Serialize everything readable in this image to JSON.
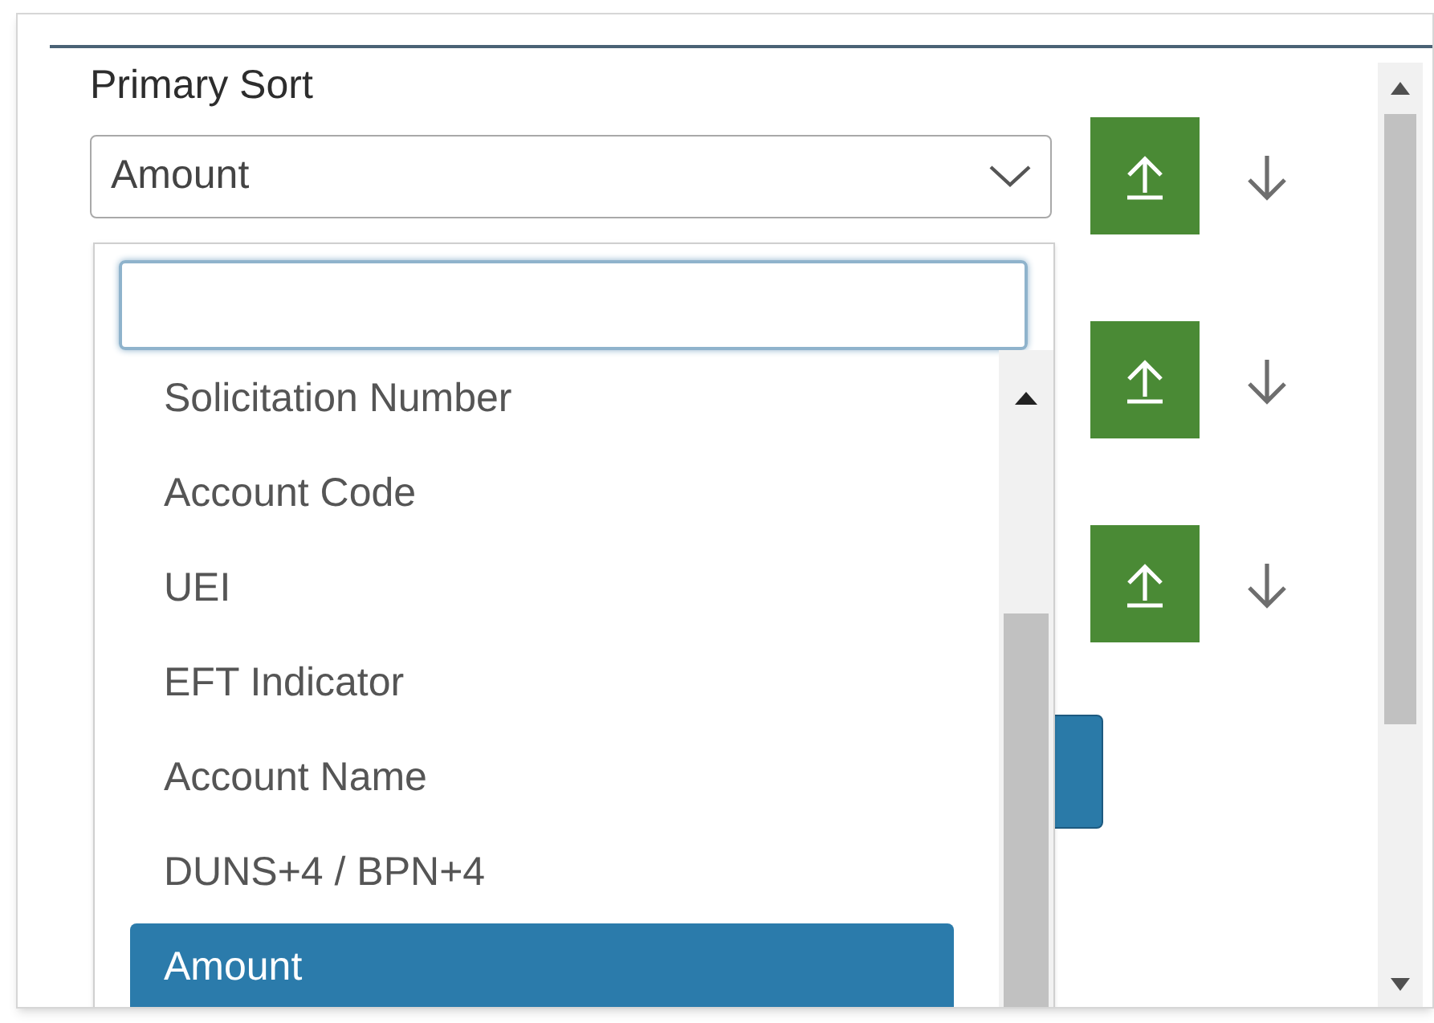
{
  "primary_sort": {
    "label": "Primary Sort",
    "value": "Amount"
  },
  "sort_rows": [
    {
      "ascending": {
        "selected": true
      },
      "descending": {
        "selected": false
      }
    },
    {
      "ascending": {
        "selected": true
      },
      "descending": {
        "selected": false
      }
    },
    {
      "ascending": {
        "selected": true
      },
      "descending": {
        "selected": false
      }
    }
  ],
  "dropdown": {
    "options": [
      {
        "label": "Solicitation Number",
        "selected": false
      },
      {
        "label": "Account Code",
        "selected": false
      },
      {
        "label": "UEI",
        "selected": false
      },
      {
        "label": "EFT Indicator",
        "selected": false
      },
      {
        "label": "Account Name",
        "selected": false
      },
      {
        "label": "DUNS+4 / BPN+4",
        "selected": false
      },
      {
        "label": "Amount",
        "selected": true
      }
    ]
  }
}
